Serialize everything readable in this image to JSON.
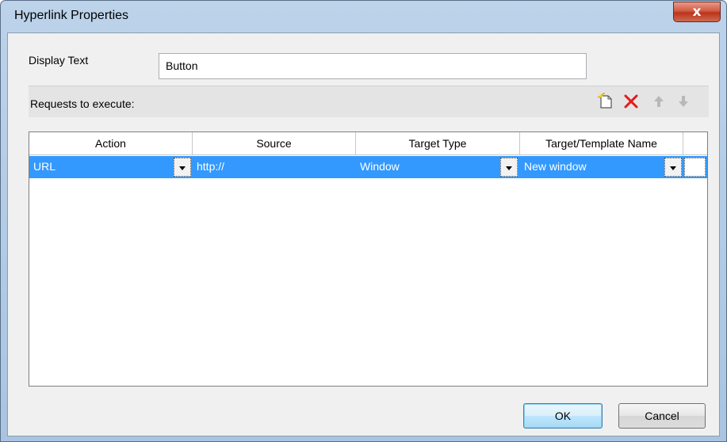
{
  "window": {
    "title": "Hyperlink Properties",
    "close_glyph": "x"
  },
  "display_text": {
    "label": "Display Text",
    "value": "Button"
  },
  "requests": {
    "label": "Requests to execute:",
    "toolbar_icons": [
      "new-request-icon",
      "delete-icon",
      "move-up-icon",
      "move-down-icon"
    ]
  },
  "grid": {
    "columns": [
      "Action",
      "Source",
      "Target Type",
      "Target/Template Name"
    ],
    "rows": [
      {
        "action": "URL",
        "source": "http://",
        "target_type": "Window",
        "target_name": "New window"
      }
    ],
    "selected_row_color": "#3399ff"
  },
  "buttons": {
    "ok": "OK",
    "cancel": "Cancel"
  }
}
